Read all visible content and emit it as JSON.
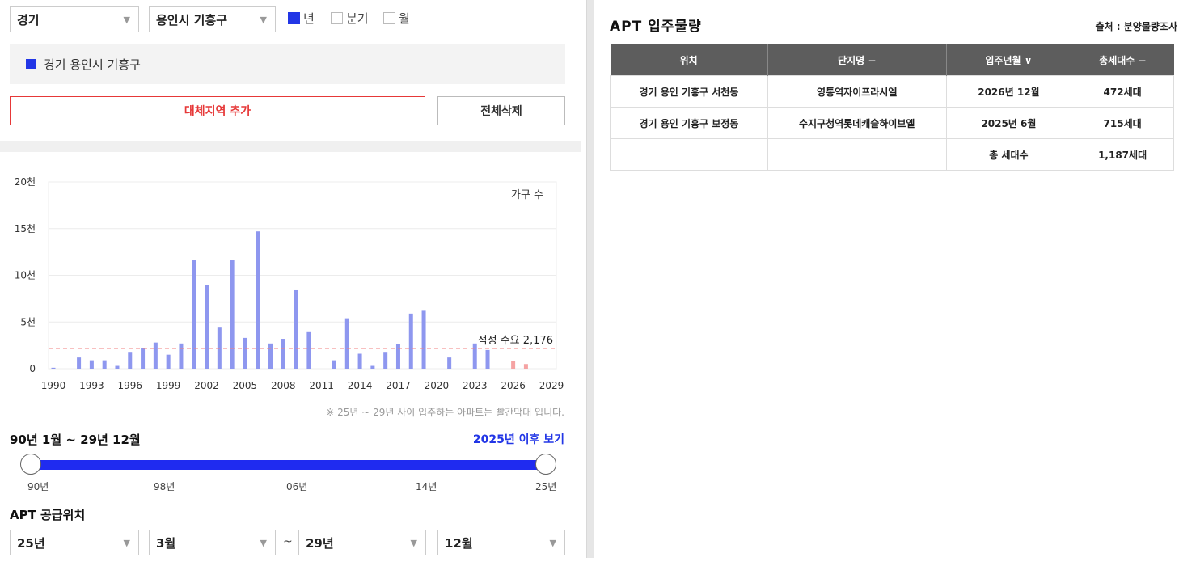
{
  "filters": {
    "province": "경기",
    "city": "용인시 기흥구",
    "periods": [
      {
        "label": "년",
        "checked": true
      },
      {
        "label": "분기",
        "checked": false
      },
      {
        "label": "월",
        "checked": false
      }
    ]
  },
  "selected_region": "경기 용인시 기흥구",
  "buttons": {
    "add_region": "대체지역 추가",
    "delete_all": "전체삭제"
  },
  "chart_data": {
    "type": "bar",
    "unit_label": "가구 수",
    "y_ticks": [
      "0",
      "5천",
      "10천",
      "15천",
      "20천"
    ],
    "ylim": [
      0,
      20000
    ],
    "x_ticks": [
      "1990",
      "1993",
      "1996",
      "1999",
      "2002",
      "2005",
      "2008",
      "2011",
      "2014",
      "2017",
      "2020",
      "2023",
      "2026",
      "2029"
    ],
    "x": [
      1990,
      1991,
      1992,
      1993,
      1994,
      1995,
      1996,
      1997,
      1998,
      1999,
      2000,
      2001,
      2002,
      2003,
      2004,
      2005,
      2006,
      2007,
      2008,
      2009,
      2010,
      2011,
      2012,
      2013,
      2014,
      2015,
      2016,
      2017,
      2018,
      2019,
      2020,
      2021,
      2022,
      2023,
      2024,
      2025,
      2026,
      2027,
      2028,
      2029
    ],
    "series": [
      {
        "color": "#8e97ef",
        "values": [
          100,
          0,
          1200,
          900,
          900,
          300,
          1800,
          2200,
          2800,
          1500,
          2700,
          11600,
          9000,
          4400,
          11600,
          3300,
          14700,
          2700,
          3200,
          8400,
          4000,
          0,
          900,
          5400,
          1600,
          300,
          1800,
          2600,
          5900,
          6200,
          0,
          1200,
          0,
          2700,
          2000,
          0,
          0,
          0,
          0,
          0
        ]
      },
      {
        "color": "#f5a3a3",
        "values": [
          0,
          0,
          0,
          0,
          0,
          0,
          0,
          0,
          0,
          0,
          0,
          0,
          0,
          0,
          0,
          0,
          0,
          0,
          0,
          0,
          0,
          0,
          0,
          0,
          0,
          0,
          0,
          0,
          0,
          0,
          0,
          0,
          0,
          0,
          0,
          0,
          800,
          500,
          0,
          0
        ]
      }
    ],
    "reference_line": {
      "label": "적정 수요 2,176",
      "value": 2176,
      "color": "#f08080"
    },
    "note": "※ 25년 ~ 29년 사이 입주하는 아파트는 빨간막대 입니다."
  },
  "range": {
    "label": "90년 1월 ~ 29년 12월",
    "after_link": "2025년 이후 보기",
    "ticks": [
      "90년",
      "98년",
      "06년",
      "14년",
      "25년"
    ]
  },
  "supply": {
    "title": "APT 공급위치",
    "from_year": "25년",
    "from_month": "3월",
    "tilde": "~",
    "to_year": "29년",
    "to_month": "12월"
  },
  "right_panel": {
    "title": "APT 입주물량",
    "source": "출처 : 분양물량조사",
    "columns": [
      "위치",
      "단지명 −",
      "입주년월 ∨",
      "총세대수 −"
    ],
    "rows": [
      [
        "경기 용인 기흥구 서천동",
        "영통역자이프라시엘",
        "2026년 12월",
        "472세대"
      ],
      [
        "경기 용인 기흥구 보정동",
        "수지구청역롯데캐슬하이브엘",
        "2025년 6월",
        "715세대"
      ],
      [
        "",
        "",
        "총 세대수",
        "1,187세대"
      ]
    ]
  }
}
